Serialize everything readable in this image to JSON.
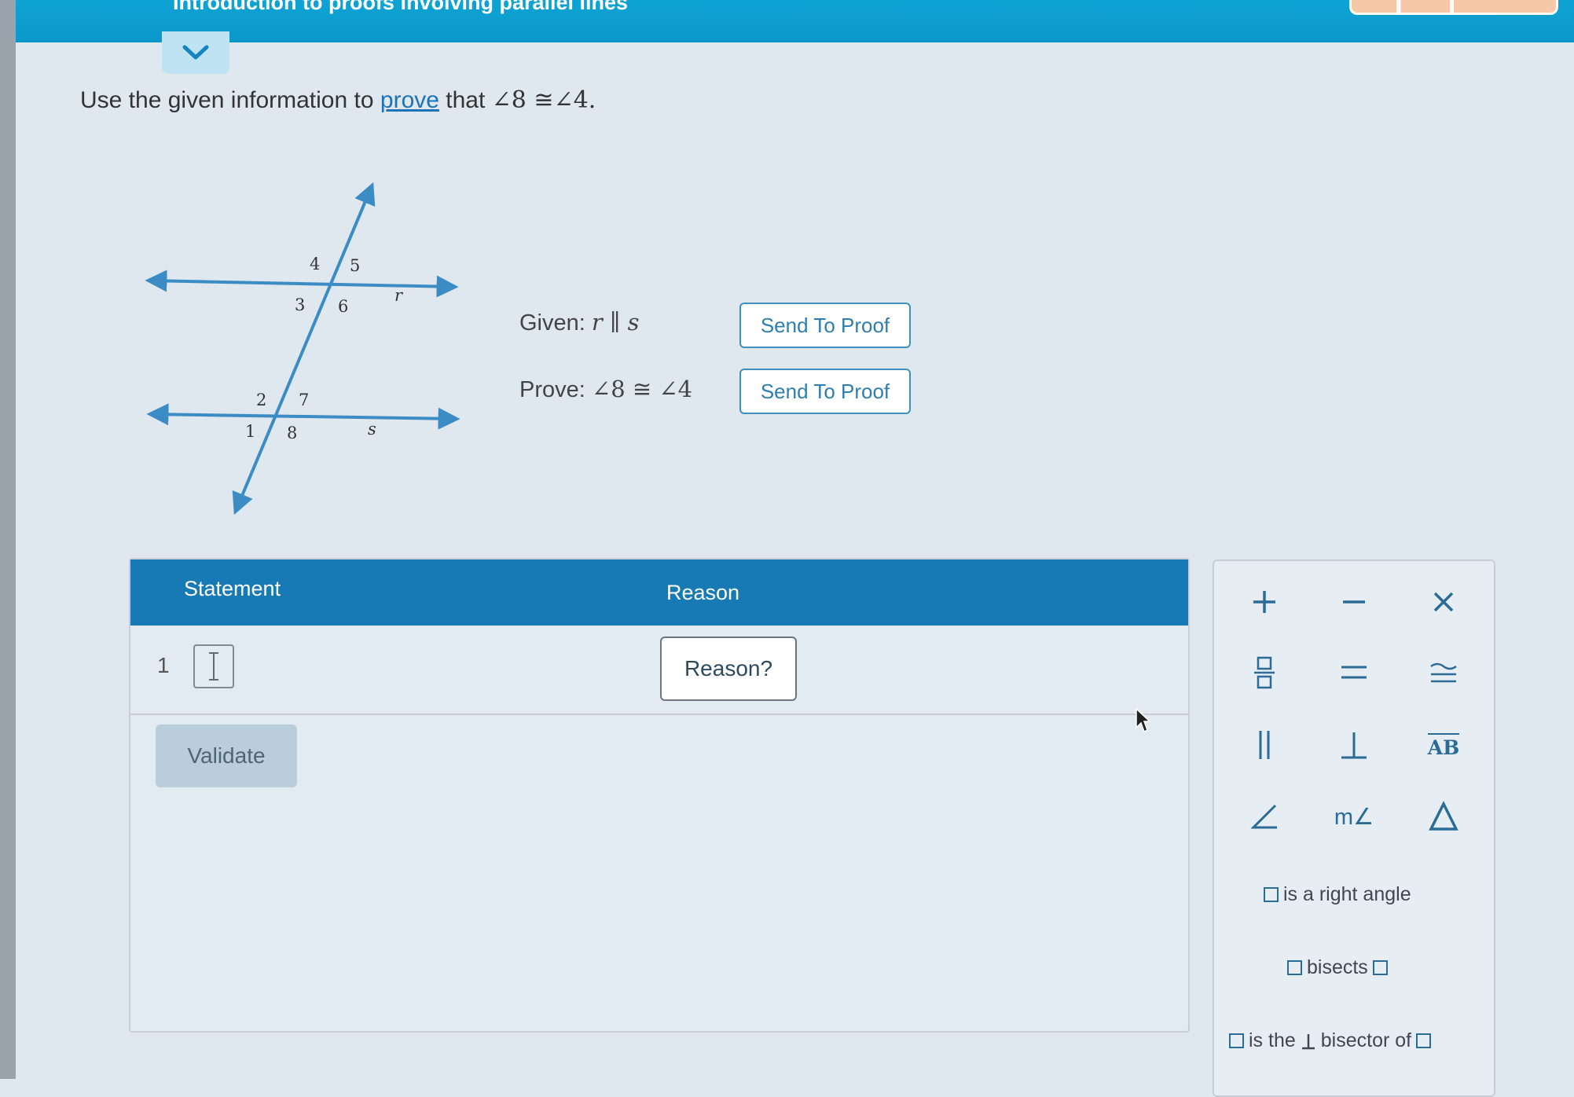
{
  "header": {
    "title": "Introduction to proofs involving parallel lines"
  },
  "problem": {
    "prefix": "Use the given information to",
    "link": "prove",
    "suffix": "that",
    "statement": "∠8 ≅∠4."
  },
  "figure": {
    "angle_labels": [
      "1",
      "2",
      "3",
      "4",
      "5",
      "6",
      "7",
      "8"
    ],
    "line_labels": [
      "r",
      "s"
    ]
  },
  "given": {
    "label": "Given:",
    "expression": "r ∥ s",
    "button": "Send To Proof"
  },
  "prove": {
    "label": "Prove:",
    "expression": "∠8 ≅ ∠4",
    "button": "Send To Proof"
  },
  "table": {
    "headers": {
      "statement": "Statement",
      "reason": "Reason"
    },
    "rows": [
      {
        "number": "1",
        "reason_button": "Reason?"
      }
    ],
    "validate_button": "Validate"
  },
  "palette": {
    "buttons": [
      "plus-icon",
      "minus-icon",
      "times-icon",
      "fraction-icon",
      "equals-icon",
      "congruent-icon",
      "parallel-icon",
      "perpendicular-icon",
      "segment-icon",
      "angle-icon",
      "measure-angle-icon",
      "triangle-icon"
    ],
    "labels": {
      "segment": "AB",
      "measure_angle": "m∠",
      "right_angle": "is a right angle",
      "bisects": "bisects",
      "perp_prefix": "is the",
      "perp_suffix": "bisector of"
    }
  },
  "colors": {
    "accent": "#187ab5",
    "header": "#0fa3d4",
    "figure_line": "#3b8cc4"
  }
}
